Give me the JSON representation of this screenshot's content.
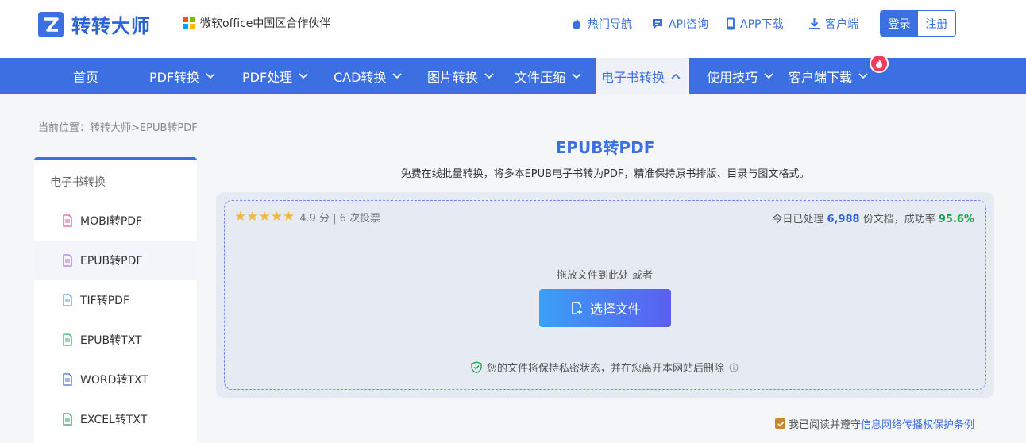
{
  "header": {
    "brand_name": "转转大师",
    "partner_text": "微软office中国区合作伙伴",
    "topnav": [
      {
        "label": "热门导航",
        "icon": "flame-icon"
      },
      {
        "label": "API咨询",
        "icon": "chat-icon"
      },
      {
        "label": "APP下载",
        "icon": "phone-icon"
      },
      {
        "label": "客户端",
        "icon": "download-icon"
      }
    ],
    "login_label": "登录",
    "register_label": "注册"
  },
  "navbar": {
    "items": [
      {
        "label": "首页"
      },
      {
        "label": "PDF转换"
      },
      {
        "label": "PDF处理"
      },
      {
        "label": "CAD转换"
      },
      {
        "label": "图片转换"
      },
      {
        "label": "文件压缩"
      },
      {
        "label": "电子书转换"
      },
      {
        "label": "使用技巧"
      },
      {
        "label": "客户端下载"
      }
    ],
    "active_index": 6
  },
  "breadcrumb": "当前位置：转转大师>EPUB转PDF",
  "sidebar": {
    "title": "电子书转换",
    "items": [
      {
        "label": "MOBI转PDF",
        "icon_color": "#e0579a"
      },
      {
        "label": "EPUB转PDF",
        "icon_color": "#a77ad8"
      },
      {
        "label": "TIF转PDF",
        "icon_color": "#48b0e0"
      },
      {
        "label": "EPUB转TXT",
        "icon_color": "#3cb371"
      },
      {
        "label": "WORD转TXT",
        "icon_color": "#3b6fe2"
      },
      {
        "label": "EXCEL转TXT",
        "icon_color": "#2e9d5a"
      }
    ],
    "active_index": 1
  },
  "main": {
    "title": "EPUB转PDF",
    "subtitle": "免费在线批量转换，将多本EPUB电子书转为PDF，精准保持原书排版、目录与图文格式。",
    "rating": {
      "stars": "★★★★★",
      "score_text": "4.9 分 | 6 次投票"
    },
    "stats": {
      "prefix": "今日已处理",
      "count": "6,988",
      "middle": "份文档，成功率",
      "rate": "95.6%"
    },
    "drop_text": "拖放文件到此处 或者",
    "select_button": "选择文件",
    "privacy_text": "您的文件将保持私密状态，并在您离开本网站后删除"
  },
  "agreement": {
    "prefix": "我已阅读并遵守",
    "link": "信息网络传播权保护条例",
    "checked": true
  },
  "colors": {
    "primary": "#3b6fe2",
    "success": "#17a34a",
    "star": "#f5b640",
    "badge": "#f23a5e"
  }
}
